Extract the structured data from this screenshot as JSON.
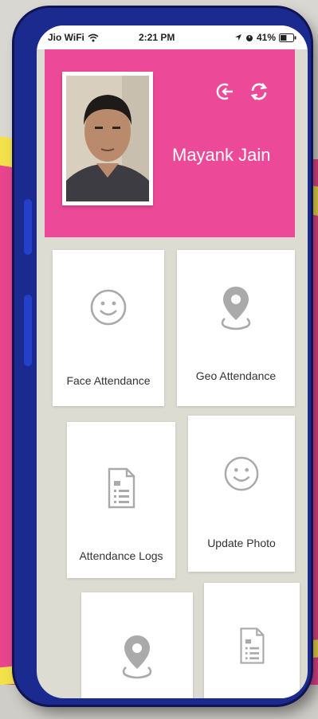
{
  "status_bar": {
    "carrier": "Jio WiFi",
    "time": "2:21 PM",
    "battery": "41%"
  },
  "profile": {
    "name": "Mayank Jain"
  },
  "header_actions": {
    "logout_icon": "logout-icon",
    "refresh_icon": "refresh-icon"
  },
  "menu": {
    "tiles": [
      {
        "label": "Face Attendance",
        "icon": "smiley-icon"
      },
      {
        "label": "Geo Attendance",
        "icon": "location-pin-icon"
      },
      {
        "label": "Attendance Logs",
        "icon": "document-icon"
      },
      {
        "label": "Update Photo",
        "icon": "smiley-icon"
      },
      {
        "label": "",
        "icon": "location-pin-icon"
      },
      {
        "label": "",
        "icon": "document-icon"
      }
    ]
  },
  "colors": {
    "header_pink": "#ec4a98",
    "backdrop_pink": "#e8458e",
    "stripe_yellow": "#f2e14a",
    "phone_blue": "#1b2a8f"
  }
}
